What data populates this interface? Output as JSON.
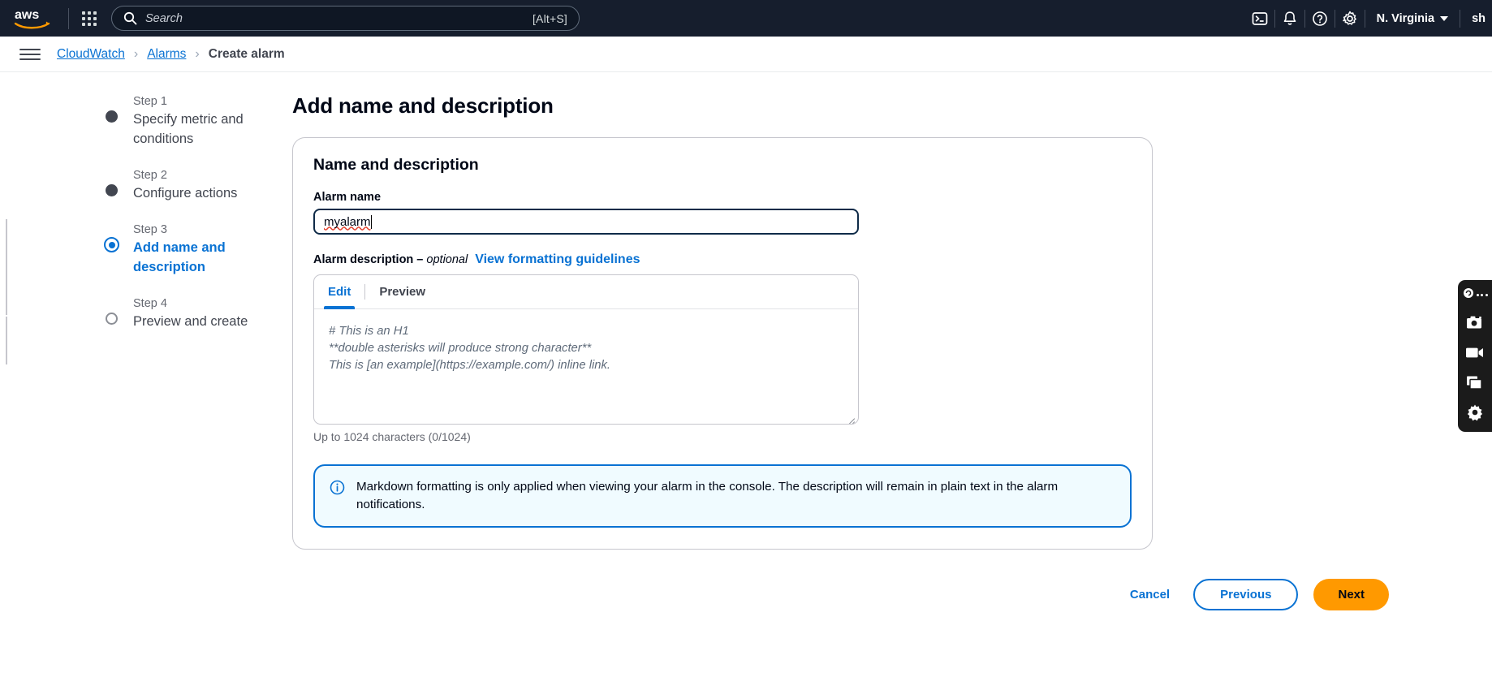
{
  "topnav": {
    "logo_alt": "aws",
    "search_placeholder": "Search",
    "search_value": "",
    "search_shortcut": "[Alt+S]",
    "region": "N. Virginia",
    "account": "sh",
    "icons": [
      "cloudshell-icon",
      "bell-icon",
      "help-icon",
      "settings-icon"
    ]
  },
  "breadcrumb": {
    "items": [
      {
        "label": "CloudWatch",
        "current": false
      },
      {
        "label": "Alarms",
        "current": false
      },
      {
        "label": "Create alarm",
        "current": true
      }
    ],
    "separator": "›"
  },
  "steps": [
    {
      "num": "Step 1",
      "title": "Specify metric and conditions",
      "state": "done"
    },
    {
      "num": "Step 2",
      "title": "Configure actions",
      "state": "done"
    },
    {
      "num": "Step 3",
      "title": "Add name and description",
      "state": "active"
    },
    {
      "num": "Step 4",
      "title": "Preview and create",
      "state": "pending"
    }
  ],
  "main": {
    "page_title": "Add name and description",
    "card_title": "Name and description",
    "alarm_name_label": "Alarm name",
    "alarm_name_value": "myalarm",
    "description_label": "Alarm description – ",
    "description_optional": "optional",
    "formatting_link": "View formatting guidelines",
    "tabs": [
      {
        "label": "Edit",
        "active": true
      },
      {
        "label": "Preview",
        "active": false
      }
    ],
    "description_placeholder": "# This is an H1\n**double asterisks will produce strong character**\nThis is [an example](https://example.com/) inline link.",
    "description_value": "",
    "counter": "Up to 1024 characters (0/1024)",
    "alert_text": "Markdown formatting is only applied when viewing your alarm in the console. The description will remain in plain text in the alarm notifications."
  },
  "actions": {
    "cancel": "Cancel",
    "previous": "Previous",
    "next": "Next"
  },
  "floatbar": {
    "items": [
      "app-logo-icon",
      "more-dots-icon",
      "camera-icon",
      "video-camera-icon",
      "windows-icon",
      "gear-icon"
    ]
  },
  "colors": {
    "nav_bg": "#161e2d",
    "link_blue": "#0972d3",
    "primary_orange": "#ff9900",
    "alert_bg": "#f0fbff",
    "text_dark": "#000716"
  }
}
